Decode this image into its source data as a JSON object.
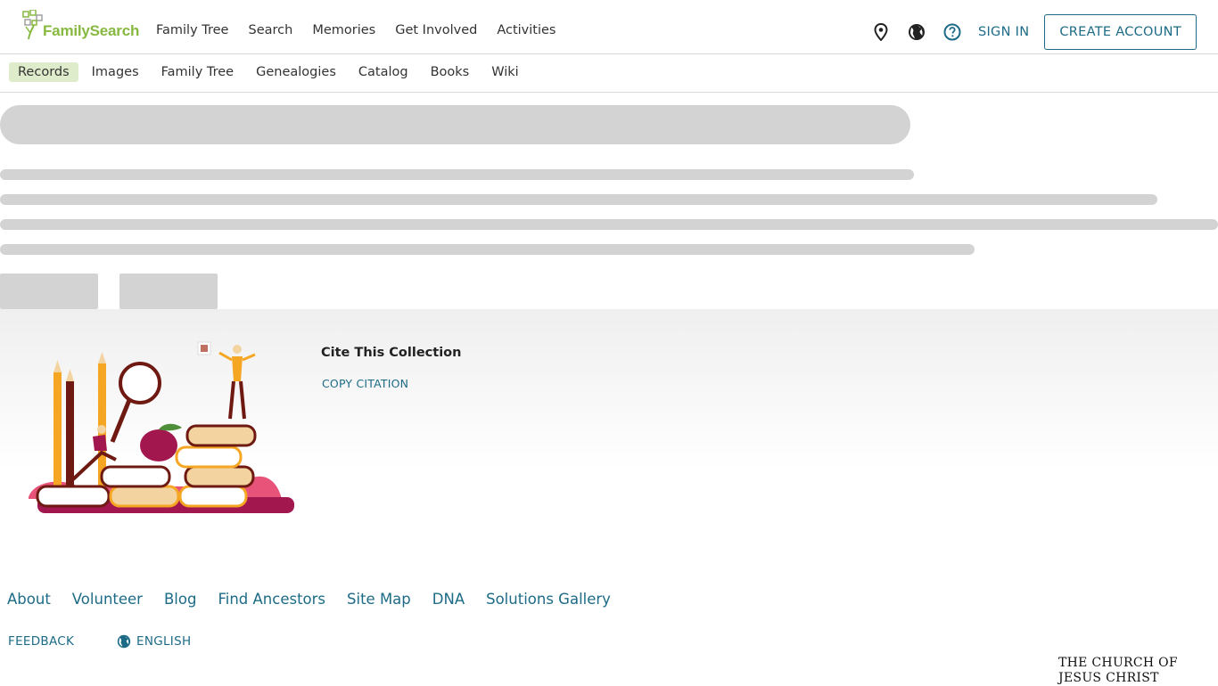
{
  "brand": {
    "name": "FamilySearch",
    "color": "#87b940"
  },
  "main_nav": [
    "Family Tree",
    "Search",
    "Memories",
    "Get Involved",
    "Activities"
  ],
  "header_actions": {
    "icons": [
      "location-pin-icon",
      "globe-icon",
      "help-icon"
    ],
    "sign_in": "SIGN IN",
    "create_account": "CREATE ACCOUNT"
  },
  "sub_nav": {
    "active": "Records",
    "items": [
      "Records",
      "Images",
      "Family Tree",
      "Genealogies",
      "Catalog",
      "Books",
      "Wiki"
    ]
  },
  "cite": {
    "title": "Cite This Collection",
    "copy_link": "COPY CITATION"
  },
  "footer": {
    "links": [
      "About",
      "Volunteer",
      "Blog",
      "Find Ancestors",
      "Site Map",
      "DNA",
      "Solutions Gallery"
    ],
    "feedback": "FEEDBACK",
    "language": "ENGLISH",
    "church_line1": "THE CHURCH OF",
    "church_line2": "JESUS CHRIST"
  },
  "colors": {
    "link": "#1d6b86",
    "active_tab_bg": "#dfeccb",
    "skeleton": "#d3d3d3"
  }
}
